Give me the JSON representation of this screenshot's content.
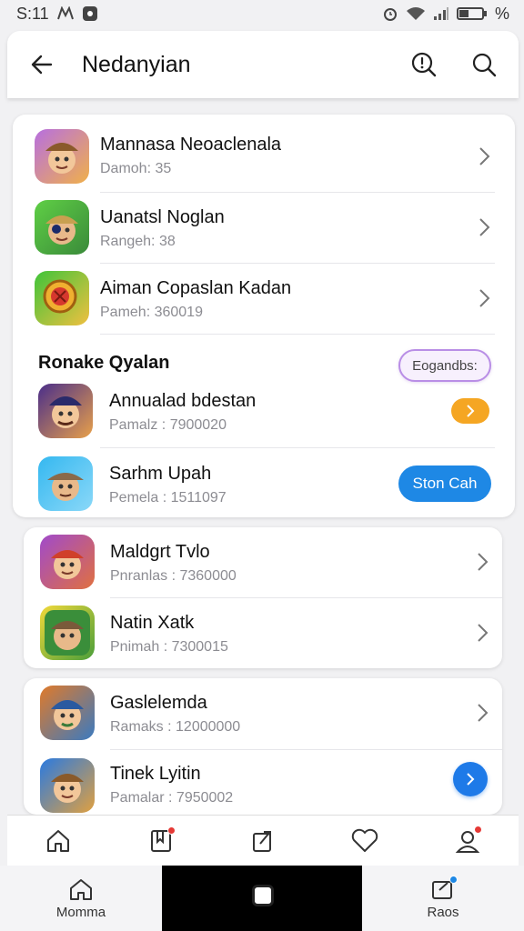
{
  "status_bar": {
    "time": "S:11",
    "battery_text": "%"
  },
  "header": {
    "title": "Nedanyian"
  },
  "list_a": [
    {
      "name": "Mannasa Neoaclenala",
      "sub": "Damoh: 35",
      "palette": [
        "#b76fe0",
        "#f0b04a"
      ]
    },
    {
      "name": "Uanatsl Noglan",
      "sub": "Rangeh: 38",
      "palette": [
        "#5fcf45",
        "#3a8a3a"
      ]
    },
    {
      "name": "Aiman Copaslan Kadan",
      "sub": "Pameh: 360019",
      "palette": [
        "#3fc43a",
        "#d6382e"
      ]
    }
  ],
  "section": {
    "title": "Ronake Qyalan",
    "pill_label": "Eogandbs:",
    "items": [
      {
        "name": "Annualad bdestan",
        "sub": "Pamalz : 7900020",
        "palette": [
          "#4a2e8a",
          "#e8a04a"
        ]
      },
      {
        "name": "Sarhm Upah",
        "sub": "Pemela : 1511097",
        "palette": [
          "#35b8f0",
          "#a88a6a"
        ],
        "action_label": "Ston Cah"
      }
    ]
  },
  "list_b": [
    {
      "name": "Maldgrt Tvlo",
      "sub": "Pnranlas : 7360000",
      "palette": [
        "#a04acb",
        "#e07040"
      ]
    },
    {
      "name": "Natin Xatk",
      "sub": "Pnimah : 7300015",
      "palette": [
        "#f2d93a",
        "#4a9e3a"
      ]
    }
  ],
  "list_c": [
    {
      "name": "Gaslelemda",
      "sub": "Ramaks : 12000000",
      "palette": [
        "#e07a2a",
        "#3a7ac0"
      ]
    },
    {
      "name": "Tinek Lyitin",
      "sub": "Pamalar : 7950002",
      "palette": [
        "#2a7ae0",
        "#e0a040"
      ]
    }
  ],
  "bottom_nav": {
    "items": [
      "home-icon",
      "bookmark-icon",
      "share-icon",
      "heart-icon",
      "profile-icon"
    ]
  },
  "sys_nav": {
    "left_label": "Momma",
    "right_label": "Raos"
  },
  "colors": {
    "accent_blue": "#1e88e5",
    "accent_orange": "#f5a623",
    "pill_border": "#b98ee6",
    "badge_red": "#e53935"
  }
}
